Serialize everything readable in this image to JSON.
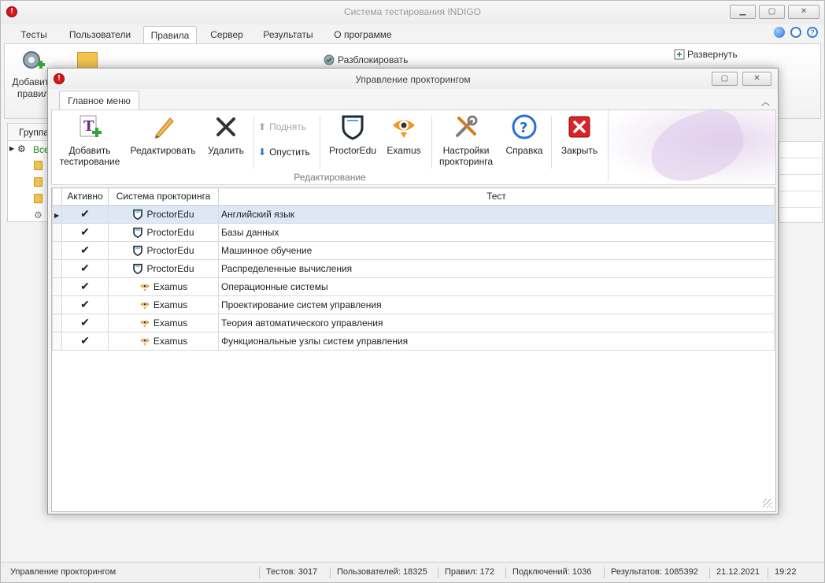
{
  "main_window": {
    "title": "Система тестирования INDIGO",
    "menu_tabs": [
      "Тесты",
      "Пользователи",
      "Правила",
      "Сервер",
      "Результаты",
      "О программе"
    ],
    "active_tab": "Правила",
    "ribbon": {
      "add_rule_label": "Добавить правил",
      "unblock_label": "Разблокировать",
      "expand_label": "Развернуть"
    },
    "left_grid_header": "Группа",
    "left_tree_first": "Все",
    "colors": {
      "accent": "#2e7d32",
      "selected_row": "#dde7f5"
    }
  },
  "dialog": {
    "title": "Управление прокторингом",
    "ribbon_tab": "Главное меню",
    "buttons": {
      "add": "Добавить тестирование",
      "edit": "Редактировать",
      "delete": "Удалить",
      "up": "Поднять",
      "down": "Опустить",
      "proctoredu": "ProctorEdu",
      "examus": "Examus",
      "settings": "Настройки прокторинга",
      "help": "Справка",
      "close": "Закрыть"
    },
    "group_label": "Редактирование",
    "grid": {
      "columns": [
        "Активно",
        "Система прокторинга",
        "Тест"
      ],
      "rows": [
        {
          "active": "✔",
          "system": "ProctorEdu",
          "test": "Английский язык"
        },
        {
          "active": "✔",
          "system": "ProctorEdu",
          "test": "Базы данных"
        },
        {
          "active": "✔",
          "system": "ProctorEdu",
          "test": "Машинное обучение"
        },
        {
          "active": "✔",
          "system": "ProctorEdu",
          "test": "Распределенные вычисления"
        },
        {
          "active": "✔",
          "system": "Examus",
          "test": "Операционные системы"
        },
        {
          "active": "✔",
          "system": "Examus",
          "test": "Проектирование систем управления"
        },
        {
          "active": "✔",
          "system": "Examus",
          "test": "Теория автоматического управления"
        },
        {
          "active": "✔",
          "system": "Examus",
          "test": "Функциональные узлы систем управления"
        }
      ]
    }
  },
  "statusbar": {
    "mode": "Управление прокторингом",
    "tests": "Тестов: 3017",
    "users": "Пользователей: 18325",
    "rules": "Правил: 172",
    "connections": "Подключений: 1036",
    "results": "Результатов: 1085392",
    "date": "21.12.2021",
    "time": "19:22"
  }
}
